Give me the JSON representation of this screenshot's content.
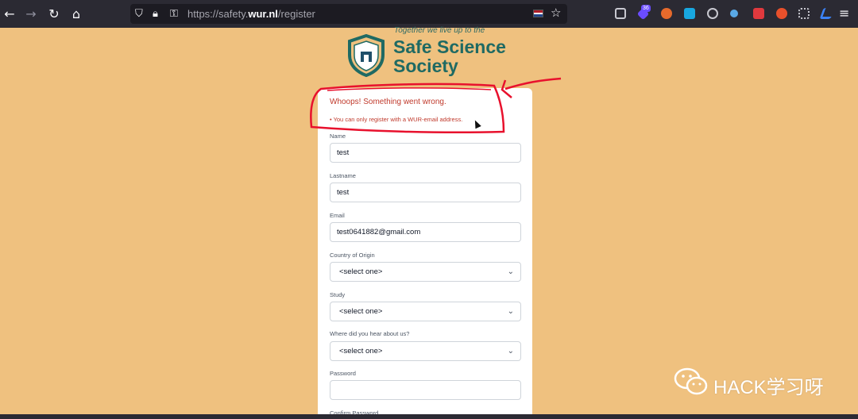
{
  "browser": {
    "url_prefix": "https://safety.",
    "url_domain": "wur.nl",
    "url_path": "/register",
    "extension_badge": "36",
    "icons": [
      "back-icon",
      "forward-icon",
      "reload-icon",
      "home-icon",
      "shield-icon",
      "lock-icon",
      "key-icon",
      "star-icon",
      "menu-icon"
    ],
    "flag_colors": [
      "#ae1c28",
      "#ffffff",
      "#21468b"
    ]
  },
  "logo": {
    "tagline": "Together we live up to the",
    "line1": "Safe Science",
    "line2": "Society",
    "color": "#1f6a63"
  },
  "errors": {
    "title": "Whoops! Something went wrong.",
    "items": [
      "• You can only register with a WUR-email address."
    ],
    "color": "#c0392b"
  },
  "form": {
    "name_label": "Name",
    "name_value": "test",
    "lastname_label": "Lastname",
    "lastname_value": "test",
    "email_label": "Email",
    "email_value": "test0641882@gmail.com",
    "country_label": "Country of Origin",
    "country_value": "<select one>",
    "study_label": "Study",
    "study_value": "<select one>",
    "hear_label": "Where did you hear about us?",
    "hear_value": "<select one>",
    "password_label": "Password",
    "password_value": "",
    "confirm_label": "Confirm Password"
  },
  "watermark": {
    "text": "HACK学习呀"
  },
  "colors": {
    "background": "#efc17f",
    "annotation": "#e8112d"
  }
}
